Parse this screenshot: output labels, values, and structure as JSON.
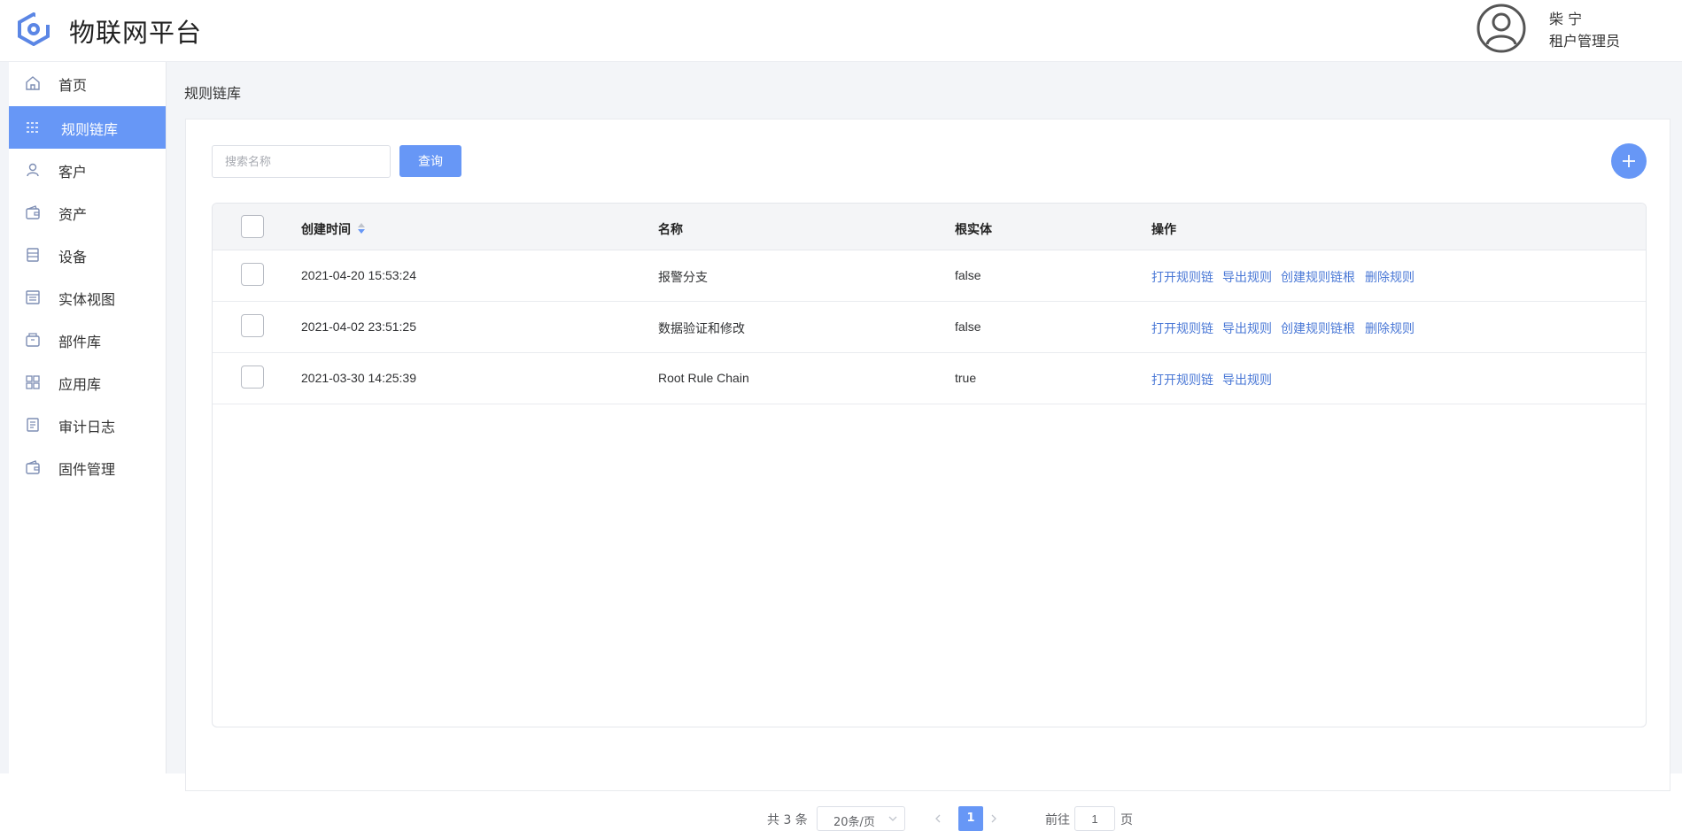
{
  "app": {
    "title": "物联网平台"
  },
  "user": {
    "name": "柴 宁",
    "role": "租户管理员"
  },
  "sidebar": {
    "items": [
      {
        "label": "首页",
        "icon": "home-icon"
      },
      {
        "label": "规则链库",
        "icon": "rule-chain-icon",
        "active": true
      },
      {
        "label": "客户",
        "icon": "user-icon"
      },
      {
        "label": "资产",
        "icon": "wallet-icon"
      },
      {
        "label": "设备",
        "icon": "device-icon"
      },
      {
        "label": "实体视图",
        "icon": "entity-view-icon"
      },
      {
        "label": "部件库",
        "icon": "widget-library-icon"
      },
      {
        "label": "应用库",
        "icon": "app-grid-icon"
      },
      {
        "label": "审计日志",
        "icon": "audit-log-icon"
      },
      {
        "label": "固件管理",
        "icon": "firmware-icon"
      }
    ]
  },
  "breadcrumb": "规则链库",
  "search": {
    "placeholder": "搜索名称",
    "value": ""
  },
  "query_label": "查询",
  "table": {
    "columns": [
      "创建时间",
      "名称",
      "根实体",
      "操作"
    ],
    "rows": [
      {
        "created": "2021-04-20 15:53:24",
        "name": "报警分支",
        "root": "false",
        "actions": [
          "打开规则链",
          "导出规则",
          "创建规则链根",
          "删除规则"
        ]
      },
      {
        "created": "2021-04-02 23:51:25",
        "name": "数据验证和修改",
        "root": "false",
        "actions": [
          "打开规则链",
          "导出规则",
          "创建规则链根",
          "删除规则"
        ]
      },
      {
        "created": "2021-03-30 14:25:39",
        "name": "Root Rule Chain",
        "root": "true",
        "actions": [
          "打开规则链",
          "导出规则"
        ]
      }
    ]
  },
  "pagination": {
    "total": "共 3 条",
    "page_size": "20条/页",
    "current": "1",
    "goto_label": "前往",
    "goto_value": "1",
    "page_label": "页"
  },
  "colors": {
    "accent": "#6797f6",
    "link": "#4a78d6",
    "icon": "#7d8db3"
  }
}
